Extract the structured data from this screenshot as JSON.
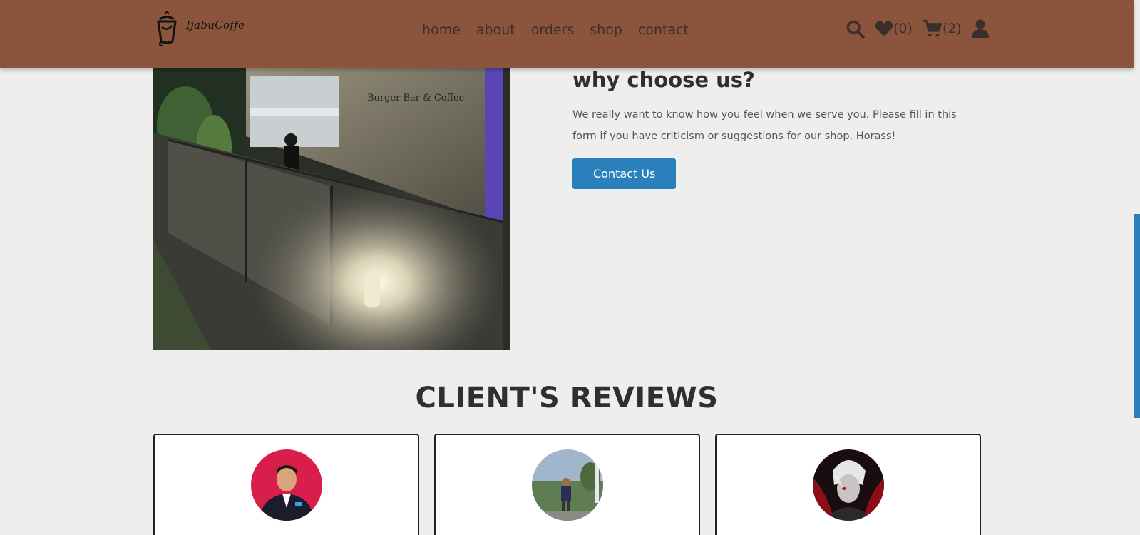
{
  "header": {
    "brand": "IjabuCoffe",
    "nav": [
      "home",
      "about",
      "orders",
      "shop",
      "contact"
    ],
    "wishlist_count": "(0)",
    "cart_count": "(2)",
    "icons": [
      "search-icon",
      "heart-icon",
      "cart-icon",
      "user-icon"
    ]
  },
  "about": {
    "heading": "why choose us?",
    "text": "We really want to know how you feel when we serve you. Please fill in this form if you have criticism or suggestions for our shop. Horass!",
    "button": "Contact Us"
  },
  "reviews": {
    "title": "CLIENT'S REVIEWS"
  },
  "colors": {
    "header_bg": "#8b553d",
    "page_bg": "#eeeeee",
    "accent": "#2a80bb"
  }
}
